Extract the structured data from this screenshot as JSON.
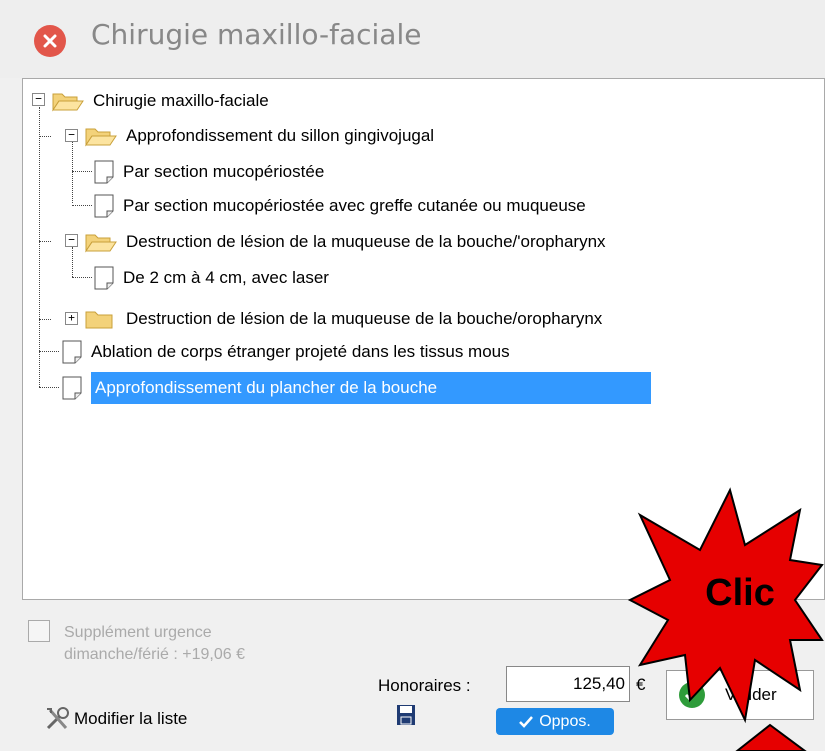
{
  "window": {
    "title": "Chirugie maxillo-faciale"
  },
  "tree": {
    "root": "Chirugie maxillo-faciale",
    "items": [
      "Approfondissement du sillon gingivojugal",
      "Par section mucopériostée",
      "Par section mucopériostée avec greffe cutanée ou muqueuse",
      "Destruction de lésion de la muqueuse de la bouche/'oropharynx",
      "De 2 cm à 4 cm, avec laser",
      "Destruction de lésion de la muqueuse de la bouche/oropharynx",
      "Ablation de corps étranger projeté dans les tissus mous",
      "Approfondissement du plancher de la bouche"
    ]
  },
  "supplement": {
    "line1": "Supplément urgence",
    "line2": "dimanche/férié : +19,06 €"
  },
  "honoraires": {
    "label": "Honoraires :",
    "value": "125,40",
    "currency": "€"
  },
  "buttons": {
    "modifier": "Modifier la liste",
    "oppos": "Oppos.",
    "valider": "Valider"
  },
  "annotation": {
    "text": "Clic"
  },
  "colors": {
    "selection": "#3399ff",
    "accent_red": "#e60000",
    "valider_green": "#2e9c3a",
    "oppos_blue": "#1e88e5"
  }
}
